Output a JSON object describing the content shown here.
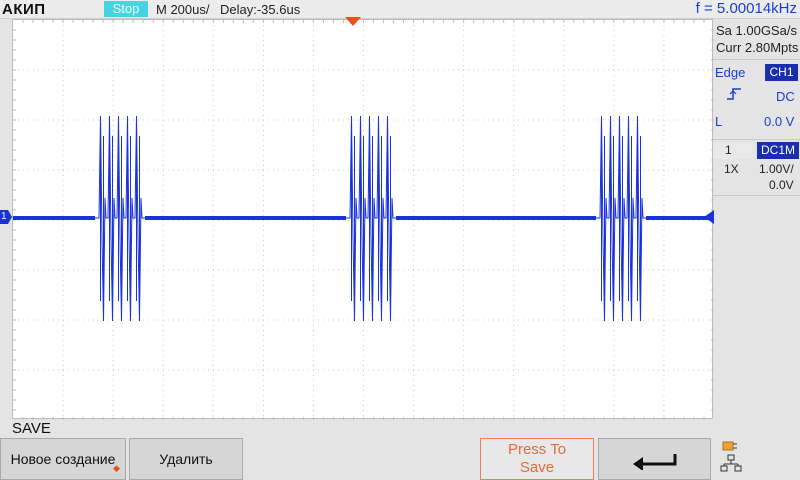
{
  "topbar": {
    "brand": "АКИП",
    "status": "Stop",
    "timebase": "M 200us/",
    "delay": "Delay:-35.6us",
    "frequency": "f = 5.00014kHz"
  },
  "acquisition": {
    "sample_rate": "Sa 1.00GSa/s",
    "memory_depth": "Curr 2.80Mpts"
  },
  "trigger": {
    "type": "Edge",
    "source": "CH1",
    "slope_icon": "rising-edge-icon",
    "coupling": "DC",
    "level_label": "L",
    "level_value": "0.0 V"
  },
  "channel": {
    "number": "1",
    "coupling_badge": "DC1M",
    "probe": "1X",
    "scale": "1.00V/",
    "offset": "0.0V",
    "marker": "1"
  },
  "waveform": {
    "color": "#1a33d8",
    "burst_count": 3,
    "pulses_per_burst": 5,
    "waveform_shape": "bursts of fast pulses around a baseline"
  },
  "menu": {
    "title": "SAVE",
    "new_label": "Новое создание",
    "delete_label": "Удалить",
    "press_to_save": "Press To Save",
    "back_icon": "return-arrow-icon",
    "storage_icon": "usb-network-icon"
  },
  "colors": {
    "accent": "#1a3fd0",
    "status_bg": "#46d4e2",
    "trigger_marker": "#e8501e",
    "save_button": "#e06a3e"
  }
}
